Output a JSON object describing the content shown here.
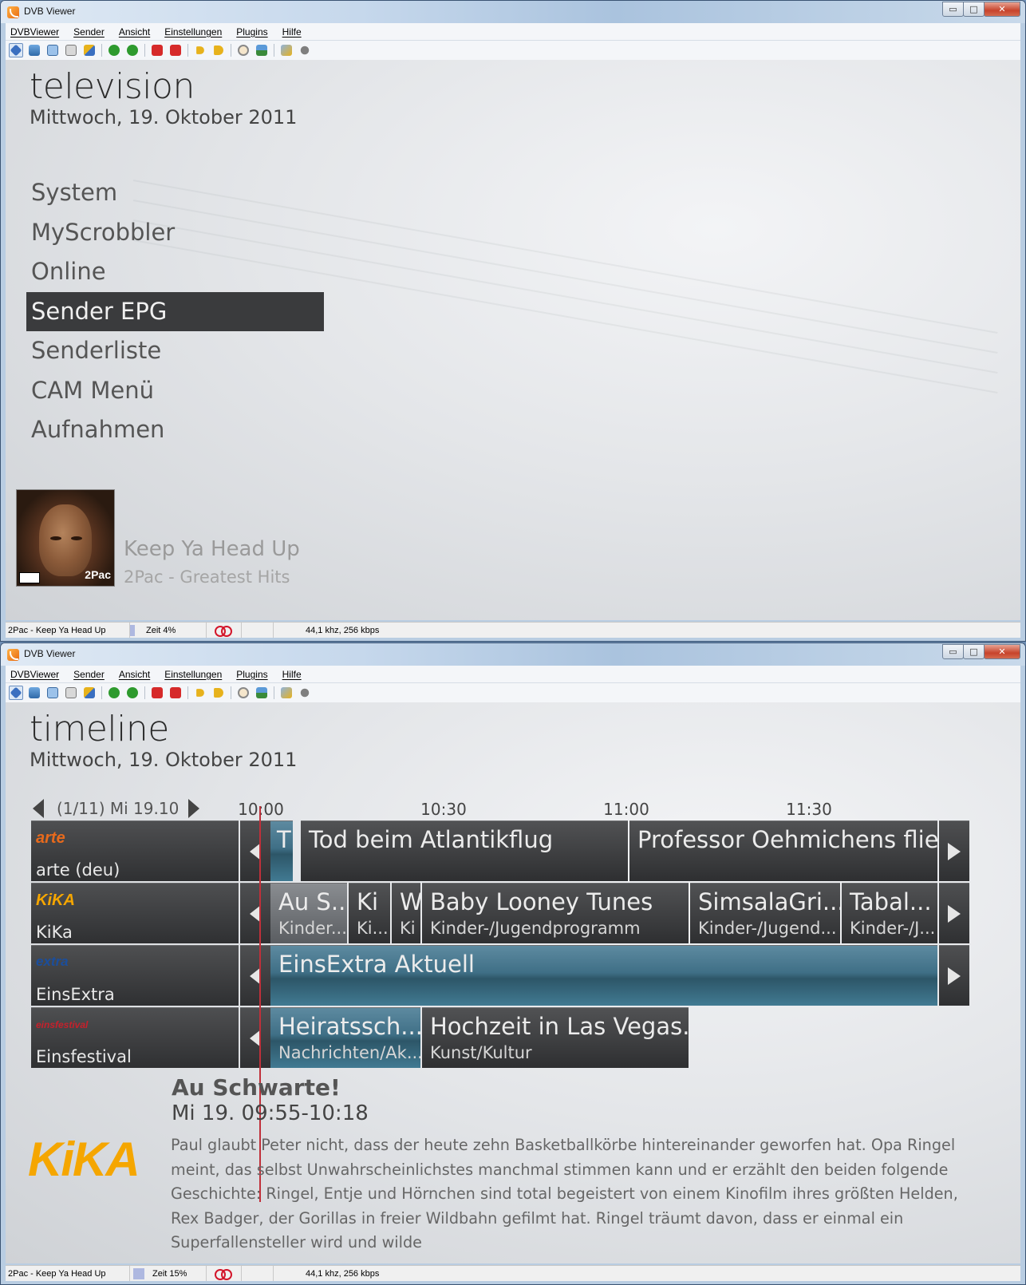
{
  "app": {
    "title": "DVB Viewer"
  },
  "menu": [
    "DVBViewer",
    "Sender",
    "Ansicht",
    "Einstellungen",
    "Plugins",
    "Hilfe"
  ],
  "window_buttons": {
    "minimize": "▭",
    "maximize": "□",
    "close": "✕"
  },
  "toolbar_icons": [
    "osd-icon",
    "screenshot-icon",
    "windows-icon",
    "teletext-icon",
    "epg-icon",
    "back-icon",
    "forward-icon",
    "prev-channel-icon",
    "next-channel-icon",
    "volume-down-icon",
    "volume-up-icon",
    "record-icon",
    "picture-icon",
    "tools-icon",
    "stop-icon"
  ],
  "colors": {
    "toolbar_green": "#2e9a2e",
    "toolbar_red": "#d62a2a",
    "toolbar_yellow": "#e7b21c",
    "nav_active_bg": "#3a3b3d",
    "now_line": "#c0303a",
    "current_program": "#3f6f86"
  },
  "screen1": {
    "page_title": "television",
    "date": "Mittwoch, 19. Oktober 2011",
    "nav_items": [
      "System",
      "MyScrobbler",
      "Online",
      "Sender EPG",
      "Senderliste",
      "CAM Menü",
      "Aufnahmen"
    ],
    "active_nav": "Sender EPG",
    "now_playing": {
      "title": "Keep Ya Head Up",
      "artist_album": "2Pac - Greatest Hits",
      "cover_brand": "2Pac"
    },
    "status": {
      "track": "2Pac - Keep Ya Head Up",
      "time": "Zeit  4%",
      "progress": 0.04,
      "audio": "44,1 khz, 256 kbps"
    }
  },
  "screen2": {
    "page_title": "timeline",
    "date": "Mittwoch, 19. Oktober 2011",
    "day_nav": "(1/11) Mi 19.10",
    "times": [
      "10:00",
      "10:30",
      "11:00",
      "11:30"
    ],
    "channels": [
      {
        "logo": "arte",
        "name": "arte (deu)",
        "logo_color": "#e86a1c"
      },
      {
        "logo": "KiKA",
        "name": "KiKa",
        "logo_color": "#f5a600"
      },
      {
        "logo": "extra",
        "name": "EinsExtra",
        "logo_color": "#1b4e9c"
      },
      {
        "logo": "einsfestival",
        "name": "Einsfestival",
        "logo_color": "#c6202b"
      }
    ],
    "programs": {
      "arte": [
        {
          "title": "T"
        },
        {
          "title": "Tod beim Atlantikflug"
        },
        {
          "title": "Professor Oehmichens flie..."
        }
      ],
      "kika": [
        {
          "title": "Au S...",
          "genre": "Kinder..."
        },
        {
          "title": "Ki",
          "genre": "Ki..."
        },
        {
          "title": "W",
          "genre": "Ki"
        },
        {
          "title": "Baby Looney Tunes",
          "genre": "Kinder-/Jugendprogramm"
        },
        {
          "title": "SimsalaGri...",
          "genre": "Kinder-/Jugend..."
        },
        {
          "title": "Tabal...",
          "genre": "Kinder-/J..."
        }
      ],
      "einsextra": [
        {
          "title": "EinsExtra Aktuell"
        }
      ],
      "einsfestival": [
        {
          "title": "Heiratssch...",
          "genre": "Nachrichten/Ak..."
        },
        {
          "title": "Hochzeit in Las Vegas...",
          "genre": "Kunst/Kultur"
        }
      ]
    },
    "details": {
      "logo": "KiKA",
      "title": "Au Schwarte!",
      "time": "Mi 19. 09:55-10:18",
      "description": "Paul glaubt Peter nicht, dass der heute zehn Basketballkörbe hintereinander geworfen hat. Opa Ringel meint, das selbst Unwahrscheinlichstes manchmal stimmen kann und er erzählt den beiden folgende Geschichte: Ringel, Entje und Hörnchen sind total begeistert von einem Kinofilm ihres größten Helden, Rex Badger, der Gorillas in freier Wildbahn gefilmt hat. Ringel träumt davon, dass er einmal ein Superfallensteller wird und wilde"
    },
    "status": {
      "track": "2Pac - Keep Ya Head Up",
      "time": "Zeit 15%",
      "progress": 0.15,
      "audio": "44,1 khz, 256 kbps"
    }
  }
}
